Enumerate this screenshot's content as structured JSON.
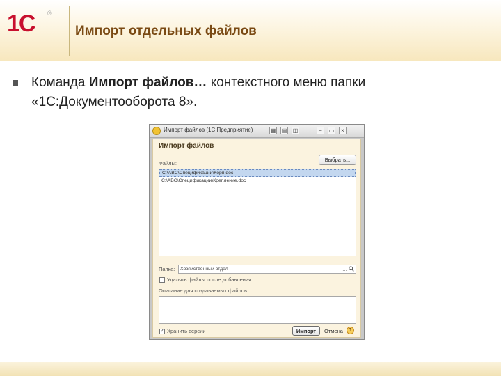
{
  "slide": {
    "logo": "1С",
    "logo_reg": "®",
    "title": "Импорт отдельных файлов",
    "bullet": {
      "text_before": "Команда ",
      "text_bold": "Импорт файлов…",
      "text_after": " контекстного меню папки «1С:Документооборота 8»."
    }
  },
  "window": {
    "title": "Импорт файлов (1С:Предприятие)",
    "controls": [
      "▦",
      "▤",
      "◫",
      "−",
      "▭",
      "×"
    ],
    "form_title": "Импорт файлов",
    "files_label": "Файлы:",
    "select_button": "Выбрать...",
    "files": [
      "C:\\ABC\\Спецификации\\Корп.doc",
      "C:\\ABC\\Спецификации\\Крепление.doc"
    ],
    "folder_label": "Папка:",
    "folder_value": "Хозяйственный отдел",
    "delete_checkbox_label": "Удалять файлы после добавления",
    "description_label": "Описание для создаваемых файлов:",
    "description_value": "",
    "keep_versions_label": "Хранить версии",
    "import_button": "Импорт",
    "cancel_button": "Отмена",
    "help_button": "?"
  },
  "colors": {
    "logo_red": "#c8102e",
    "title_brown": "#7a4a14",
    "form_bg": "#fbf3df",
    "selection": "#c3d7ef"
  }
}
